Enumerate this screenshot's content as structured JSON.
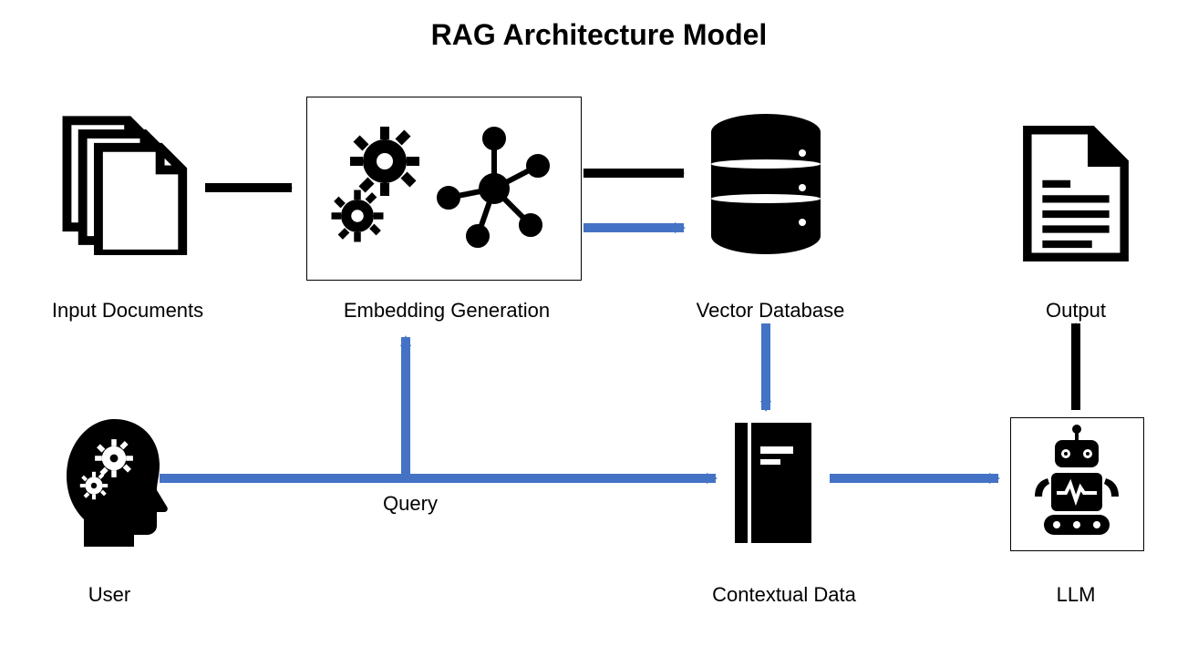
{
  "title": "RAG Architecture Model",
  "nodes": {
    "input_documents": {
      "label": "Input Documents"
    },
    "embedding_generation": {
      "label": "Embedding Generation"
    },
    "vector_database": {
      "label": "Vector Database"
    },
    "output": {
      "label": "Output"
    },
    "user": {
      "label": "User"
    },
    "contextual_data": {
      "label": "Contextual Data"
    },
    "llm": {
      "label": "LLM"
    }
  },
  "edges": {
    "query": {
      "label": "Query"
    }
  },
  "colors": {
    "black": "#000000",
    "accent_blue": "#4472C4"
  },
  "flow": [
    "Input Documents -> Embedding Generation",
    "Embedding Generation -> Vector Database",
    "User -> (Query) -> Contextual Data",
    "Query -> Embedding Generation",
    "Embedding Generation -> Vector Database (query path)",
    "Vector Database -> Contextual Data",
    "Contextual Data -> LLM",
    "LLM -> Output"
  ]
}
